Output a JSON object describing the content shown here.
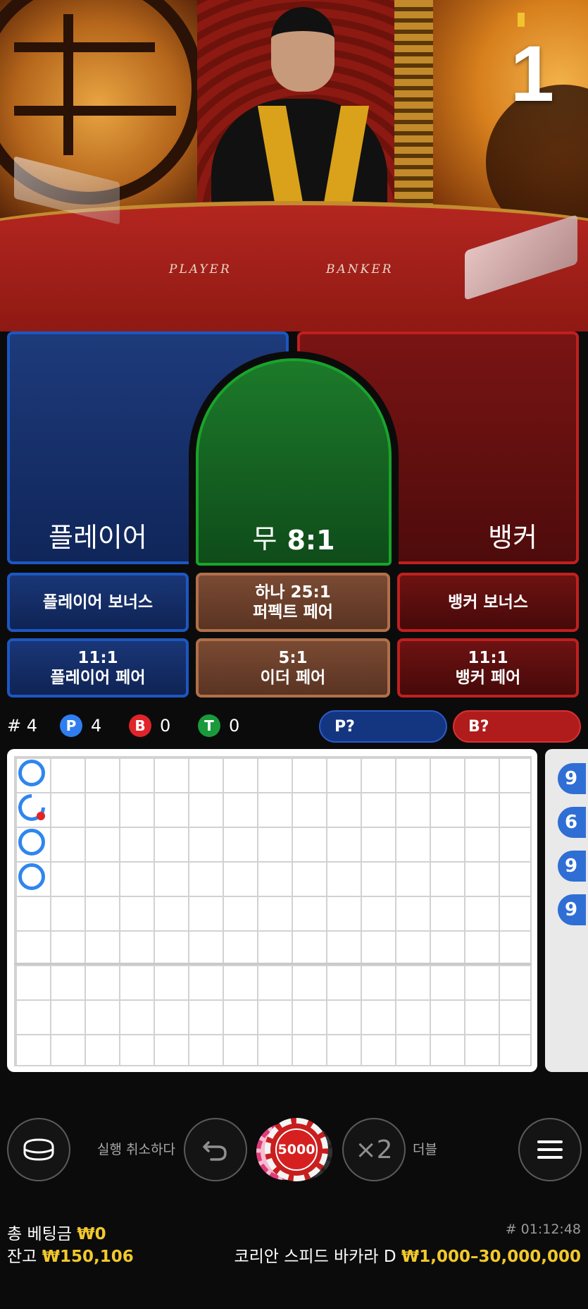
{
  "video": {
    "table_labels": {
      "player": "PLAYER",
      "banker": "BANKER"
    },
    "countdown": "1"
  },
  "bets": {
    "player": "플레이어",
    "tie_label": "무",
    "tie_odds": "8:1",
    "banker": "뱅커",
    "player_bonus": "플레이어 보너스",
    "perfect_pair_line1": "하나 25:1",
    "perfect_pair_line2": "퍼펙트 페어",
    "banker_bonus": "뱅커 보너스",
    "player_pair_odds": "11:1",
    "player_pair_label": "플레이어 페어",
    "either_pair_odds": "5:1",
    "either_pair_label": "이더 페어",
    "banker_pair_odds": "11:1",
    "banker_pair_label": "뱅커 페어"
  },
  "stats": {
    "round_number": "# 4",
    "player_letter": "P",
    "player_count": "4",
    "banker_letter": "B",
    "banker_count": "0",
    "tie_letter": "T",
    "tie_count": "0",
    "player_predict": "P?",
    "banker_predict": "B?"
  },
  "roadmap": {
    "results": [
      "P",
      "P",
      "P",
      "P"
    ],
    "side_road_glyphs": [
      "9",
      "6",
      "9",
      "9"
    ]
  },
  "controls": {
    "undo_label": "실행 취소하다",
    "chip_value": "5000",
    "double_symbol": "×2",
    "double_label": "더블"
  },
  "footer": {
    "total_bet_label": "총 베팅금",
    "total_bet_value": "₩0",
    "balance_label": "잔고",
    "balance_value": "₩150,106",
    "game_id": "# 01:12:48",
    "table_name": "코리안 스피드 바카라 D",
    "limits": "₩1,000–30,000,000"
  },
  "colors": {
    "player_blue": "#1c57c2",
    "banker_red": "#c0201e",
    "tie_green": "#19a42a",
    "gold": "#f2c92b"
  }
}
